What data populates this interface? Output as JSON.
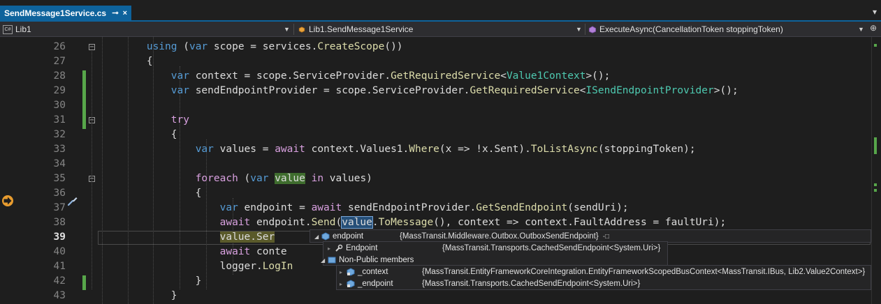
{
  "tab": {
    "title": "SendMessage1Service.cs",
    "pin": "⊸",
    "close": "×",
    "overflow": "▾"
  },
  "navbar": {
    "project": "Lib1",
    "project_icon_text": "C#",
    "class": "Lib1.SendMessage1Service",
    "member": "ExecuteAsync(CancellationToken stoppingToken)"
  },
  "editor": {
    "lines": [
      {
        "num": "26",
        "tokens": [
          {
            "t": "        "
          },
          {
            "t": "using",
            "c": "kw"
          },
          {
            "t": " ("
          },
          {
            "t": "var",
            "c": "kw"
          },
          {
            "t": " scope = services."
          },
          {
            "t": "CreateScope",
            "c": "fn"
          },
          {
            "t": "())"
          }
        ]
      },
      {
        "num": "27",
        "tokens": [
          {
            "t": "        {"
          }
        ]
      },
      {
        "num": "28",
        "tokens": [
          {
            "t": "            "
          },
          {
            "t": "var",
            "c": "kw"
          },
          {
            "t": " context = scope.ServiceProvider."
          },
          {
            "t": "GetRequiredService",
            "c": "fn"
          },
          {
            "t": "<"
          },
          {
            "t": "Value1Context",
            "c": "type"
          },
          {
            "t": ">();"
          }
        ]
      },
      {
        "num": "29",
        "tokens": [
          {
            "t": "            "
          },
          {
            "t": "var",
            "c": "kw"
          },
          {
            "t": " sendEndpointProvider = scope.ServiceProvider."
          },
          {
            "t": "GetRequiredService",
            "c": "fn"
          },
          {
            "t": "<"
          },
          {
            "t": "ISendEndpointProvider",
            "c": "type"
          },
          {
            "t": ">();"
          }
        ]
      },
      {
        "num": "30",
        "tokens": [
          {
            "t": ""
          }
        ]
      },
      {
        "num": "31",
        "tokens": [
          {
            "t": "            "
          },
          {
            "t": "try",
            "c": "ctl"
          }
        ]
      },
      {
        "num": "32",
        "tokens": [
          {
            "t": "            {"
          }
        ]
      },
      {
        "num": "33",
        "tokens": [
          {
            "t": "                "
          },
          {
            "t": "var",
            "c": "kw"
          },
          {
            "t": " values = "
          },
          {
            "t": "await",
            "c": "ctl"
          },
          {
            "t": " context.Values1."
          },
          {
            "t": "Where",
            "c": "fn"
          },
          {
            "t": "(x => !x.Sent)."
          },
          {
            "t": "ToListAsync",
            "c": "fn"
          },
          {
            "t": "(stoppingToken);"
          }
        ]
      },
      {
        "num": "34",
        "tokens": [
          {
            "t": ""
          }
        ]
      },
      {
        "num": "35",
        "tokens": [
          {
            "t": "                "
          },
          {
            "t": "foreach",
            "c": "ctl"
          },
          {
            "t": " ("
          },
          {
            "t": "var",
            "c": "kw"
          },
          {
            "t": " "
          },
          {
            "t": "value",
            "c": "hl-green"
          },
          {
            "t": " "
          },
          {
            "t": "in",
            "c": "ctl"
          },
          {
            "t": " values)"
          }
        ]
      },
      {
        "num": "36",
        "tokens": [
          {
            "t": "                {"
          }
        ]
      },
      {
        "num": "37",
        "tokens": [
          {
            "t": "                    "
          },
          {
            "t": "var",
            "c": "kw"
          },
          {
            "t": " endpoint = "
          },
          {
            "t": "await",
            "c": "ctl"
          },
          {
            "t": " sendEndpointProvider."
          },
          {
            "t": "GetSendEndpoint",
            "c": "fn"
          },
          {
            "t": "(sendUri);"
          }
        ]
      },
      {
        "num": "38",
        "tokens": [
          {
            "t": "                    "
          },
          {
            "t": "await",
            "c": "ctl"
          },
          {
            "t": " endpoint."
          },
          {
            "t": "Send",
            "c": "fn"
          },
          {
            "t": "("
          },
          {
            "t": "value",
            "c": "hl-sel"
          },
          {
            "t": "."
          },
          {
            "t": "ToMessage",
            "c": "fn"
          },
          {
            "t": "(), context => context.FaultAddress = faultUri);"
          }
        ]
      },
      {
        "num": "39",
        "tokens": [
          {
            "t": "                    "
          },
          {
            "t": "value.Ser",
            "c": "hl-cur"
          }
        ]
      },
      {
        "num": "40",
        "tokens": [
          {
            "t": "                    "
          },
          {
            "t": "await",
            "c": "ctl"
          },
          {
            "t": " conte"
          }
        ]
      },
      {
        "num": "41",
        "tokens": [
          {
            "t": "                    logger."
          },
          {
            "t": "LogIn",
            "c": "fn"
          }
        ]
      },
      {
        "num": "42",
        "tokens": [
          {
            "t": "                }"
          }
        ]
      },
      {
        "num": "43",
        "tokens": [
          {
            "t": "            }"
          }
        ]
      }
    ]
  },
  "datatip": {
    "main": {
      "name": "endpoint",
      "value": "{MassTransit.Middleware.Outbox.OutboxSendEndpoint}",
      "pin": "-□"
    },
    "rows": [
      {
        "name": "Endpoint",
        "value": "{MassTransit.Transports.CachedSendEndpoint<System.Uri>}"
      },
      {
        "name": "Non-Public members",
        "value": ""
      }
    ],
    "nested": [
      {
        "name": "_context",
        "value": "{MassTransit.EntityFrameworkCoreIntegration.EntityFrameworkScopedBusContext<MassTransit.IBus, Lib2.Value2Context>}"
      },
      {
        "name": "_endpoint",
        "value": "{MassTransit.Transports.CachedSendEndpoint<System.Uri>}"
      }
    ]
  },
  "colors": {
    "accent": "#0e639c",
    "changed": "#57a64a",
    "breakpoint": "#e89c2f"
  }
}
